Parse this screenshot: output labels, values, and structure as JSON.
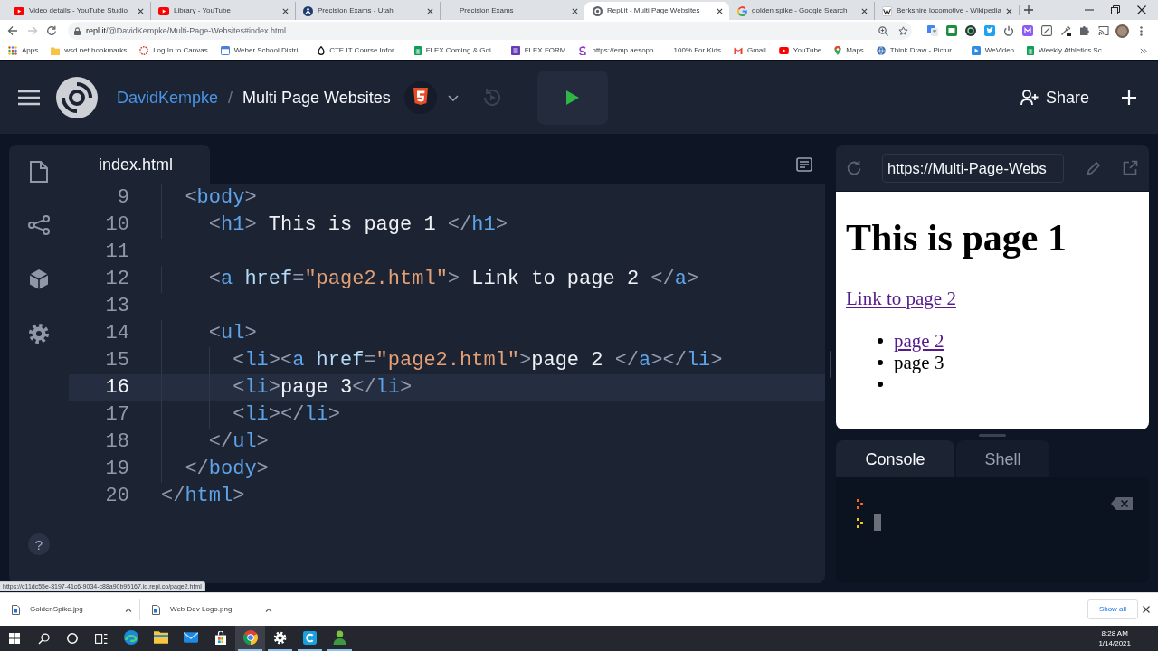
{
  "browser": {
    "tabs": [
      {
        "title": "Video details - YouTube Studio",
        "selected": false
      },
      {
        "title": "Library - YouTube",
        "selected": false
      },
      {
        "title": "Precision Exams - Utah",
        "selected": false
      },
      {
        "title": "Precision Exams",
        "selected": false
      },
      {
        "title": "Repl.it - Multi Page Websites",
        "selected": true
      },
      {
        "title": "golden spike - Google Search",
        "selected": false
      },
      {
        "title": "Berkshire locomotive - Wikipedia",
        "selected": false
      }
    ],
    "forward_disabled": true,
    "address": {
      "host": "repl.it",
      "path": "/@DavidKempke/Multi-Page-Websites#index.html"
    },
    "bookmarks": [
      "Apps",
      "wsd.net bookmarks",
      "Log In to Canvas",
      "Weber School Distri…",
      "CTE IT Course Infor…",
      "FLEX Coming & Goi…",
      "FLEX FORM",
      "https://emp.aesopo…",
      "100% For Kids",
      "Gmail",
      "YouTube",
      "Maps",
      "Think Draw - Pictur…",
      "WeVideo",
      "Weekly Athletics Sc…"
    ],
    "status_url": "https://c11dc55e-8197-41c6-9034-c88a90b95167.id.repl.co/page2.html"
  },
  "replit": {
    "owner": "DavidKempke",
    "separator": "/",
    "repl_name": "Multi Page Websites",
    "share": "Share",
    "help": "?"
  },
  "editor": {
    "file_tab": "index.html",
    "lines": [
      {
        "number": "9",
        "text": "  <body>",
        "current": false
      },
      {
        "number": "10",
        "text": "    <h1> This is page 1 </h1>",
        "current": false
      },
      {
        "number": "11",
        "current": false
      },
      {
        "number": "12",
        "text": "    <a href=\"page2.html\"> Link to page 2 </a>",
        "current": false
      },
      {
        "number": "13",
        "current": false
      },
      {
        "number": "14",
        "text": "    <ul>",
        "current": false
      },
      {
        "number": "15",
        "text": "      <li><a href=\"page2.html\">page 2 </a></li>",
        "current": false
      },
      {
        "number": "16",
        "text": "      <li>page 3</li>",
        "current": true
      },
      {
        "number": "17",
        "text": "      <li></li>",
        "current": false
      },
      {
        "number": "18",
        "text": "    </ul>",
        "current": false
      },
      {
        "number": "19",
        "text": "  </body>",
        "current": false
      },
      {
        "number": "20",
        "text": "</html>",
        "current": false
      }
    ]
  },
  "preview": {
    "url": "https://Multi-Page-Webs",
    "heading": "This is page 1",
    "link": "Link to page 2",
    "items": [
      {
        "kind": "link",
        "text": "page 2"
      },
      {
        "kind": "text",
        "text": "page 3"
      },
      {
        "kind": "empty"
      }
    ]
  },
  "console": {
    "tabs": [
      {
        "label": "Console",
        "selected": true
      },
      {
        "label": "Shell",
        "selected": false
      }
    ]
  },
  "downloads": {
    "files": [
      "GoldenSpike.jpg",
      "Web Dev Logo.png"
    ],
    "show_all": "Show all"
  },
  "taskbar": {
    "apps": [
      {
        "running": false,
        "active": false
      },
      {
        "running": false,
        "active": false
      },
      {
        "running": false,
        "active": false
      },
      {
        "running": false,
        "active": false
      },
      {
        "running": true,
        "active": true
      },
      {
        "running": true,
        "active": false
      },
      {
        "running": true,
        "active": false
      },
      {
        "running": true,
        "active": false
      }
    ],
    "time": "8:28 AM",
    "date": "1/14/2021"
  }
}
